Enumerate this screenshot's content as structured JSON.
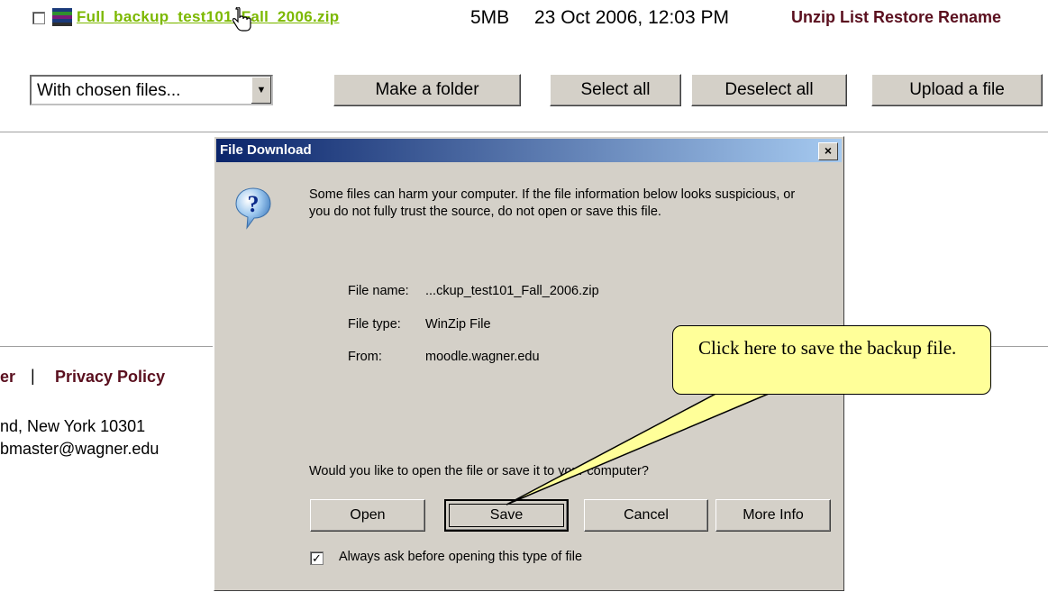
{
  "file_row": {
    "filename": "Full_backup_test101_Fall_2006.zip",
    "size": "5MB",
    "date": "23 Oct 2006, 12:03 PM",
    "actions": "Unzip List Restore Rename"
  },
  "controls": {
    "select_value": "With chosen files...",
    "make_folder": "Make a folder",
    "select_all": "Select all",
    "deselect_all": "Deselect all",
    "upload": "Upload a file"
  },
  "footer": {
    "partial_link": "er",
    "separator": "|",
    "privacy": "Privacy Policy",
    "address": "nd, New York 10301",
    "email": "bmaster@wagner.edu"
  },
  "dialog": {
    "title": "File Download",
    "close": "×",
    "warning": "Some files can harm your computer. If the file information below looks suspicious, or you do not fully trust the source, do not open or save this file.",
    "file_name_label": "File name:",
    "file_name_value": "...ckup_test101_Fall_2006.zip",
    "file_type_label": "File type:",
    "file_type_value": "WinZip File",
    "from_label": "From:",
    "from_value": "moodle.wagner.edu",
    "question": "Would you like to open the file or save it to your computer?",
    "open": "Open",
    "save": "Save",
    "cancel": "Cancel",
    "more_info": "More Info",
    "always_ask": "Always ask before opening this type of file",
    "always_ask_checked": true
  },
  "callout": {
    "text": "Click here to save the backup file."
  },
  "icons": {
    "zip": "zip-archive-icon",
    "question": "question-icon",
    "cursor": "hand-cursor-icon",
    "dropdown": "chevron-down-icon"
  },
  "colors": {
    "link_green": "#7cb800",
    "action_maroon": "#5a0f1e",
    "titlebar_start": "#0a246a",
    "titlebar_end": "#a6caf0",
    "callout_fill": "#ffff99"
  }
}
